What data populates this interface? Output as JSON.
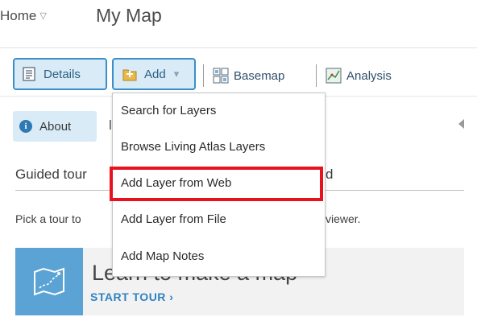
{
  "header": {
    "home_label": "Home",
    "home_caret": "▽",
    "title": "My Map"
  },
  "toolbar": {
    "details_label": "Details",
    "add_label": "Add",
    "add_caret": "▾",
    "basemap_label": "Basemap",
    "analysis_label": "Analysis"
  },
  "add_menu": {
    "items": [
      "Search for Layers",
      "Browse Living Atlas Layers",
      "Add Layer from Web",
      "Add Layer from File",
      "Add Map Notes"
    ],
    "highlighted_item": "Add Layer from Web"
  },
  "panel": {
    "about_label": "About",
    "info_glyph": "i",
    "partial_tab_fragment": "l",
    "guided_tours_heading_visible_left": "Guided tour",
    "guided_tours_heading_visible_right": "d",
    "pick_text_visible_left": "Pick a tour to",
    "pick_text_visible_right": "viewer.",
    "tour_card": {
      "title": "Learn to make a map",
      "cta": "START TOUR ›"
    }
  },
  "colors": {
    "accent": "#3a8fc8",
    "button_bg": "#d8ebf7",
    "highlight_box": "#e8121e",
    "tour_icon_bg": "#5aa3d4",
    "link": "#2f82c2"
  },
  "icons": [
    "details-icon",
    "add-layer-icon",
    "basemap-grid-icon",
    "analysis-icon",
    "info-icon",
    "collapse-left-icon",
    "map-route-icon"
  ]
}
